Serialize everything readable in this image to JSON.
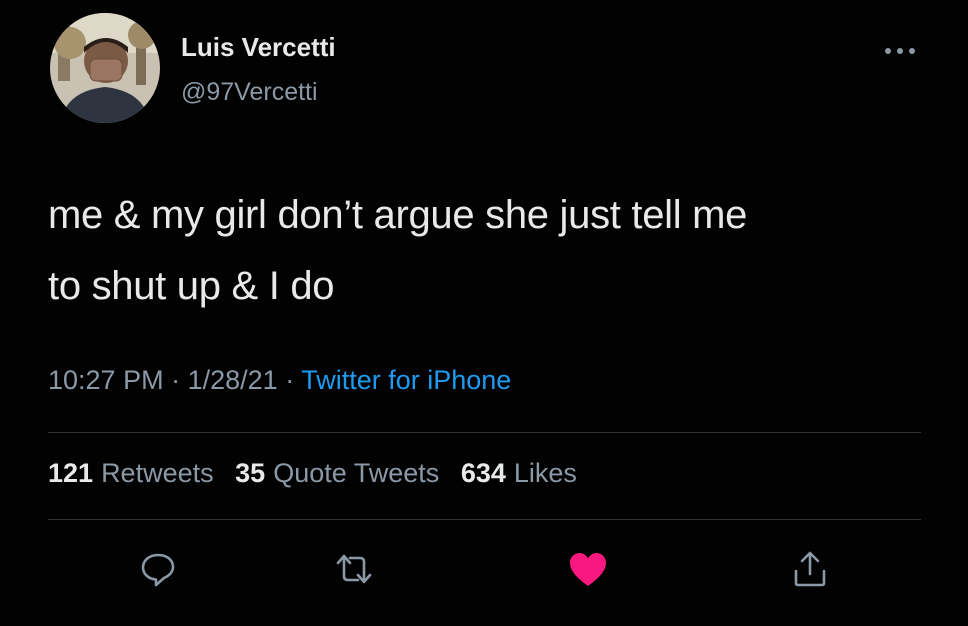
{
  "user": {
    "display_name": "Luis Vercetti",
    "handle": "@97Vercetti",
    "avatar_icon": "avatar-photo"
  },
  "tweet": {
    "text_line_1": "me & my girl don’t argue she just tell me",
    "text_line_2": "to shut up & I do",
    "time": "10:27 PM",
    "separator": "·",
    "date": "1/28/21",
    "source": "Twitter for iPhone"
  },
  "stats": {
    "retweets_count": "121",
    "retweets_label": "Retweets",
    "quotes_count": "35",
    "quotes_label": "Quote Tweets",
    "likes_count": "634",
    "likes_label": "Likes"
  },
  "actions": {
    "reply_icon": "reply-icon",
    "retweet_icon": "retweet-icon",
    "like_icon": "heart-icon",
    "share_icon": "share-icon",
    "more_icon": "more-icon"
  },
  "colors": {
    "background": "#020202",
    "text": "#e7e9ea",
    "secondary_text": "#8b98a5",
    "link": "#1d9bf0",
    "like": "#f91880",
    "divider": "#2f3336"
  }
}
